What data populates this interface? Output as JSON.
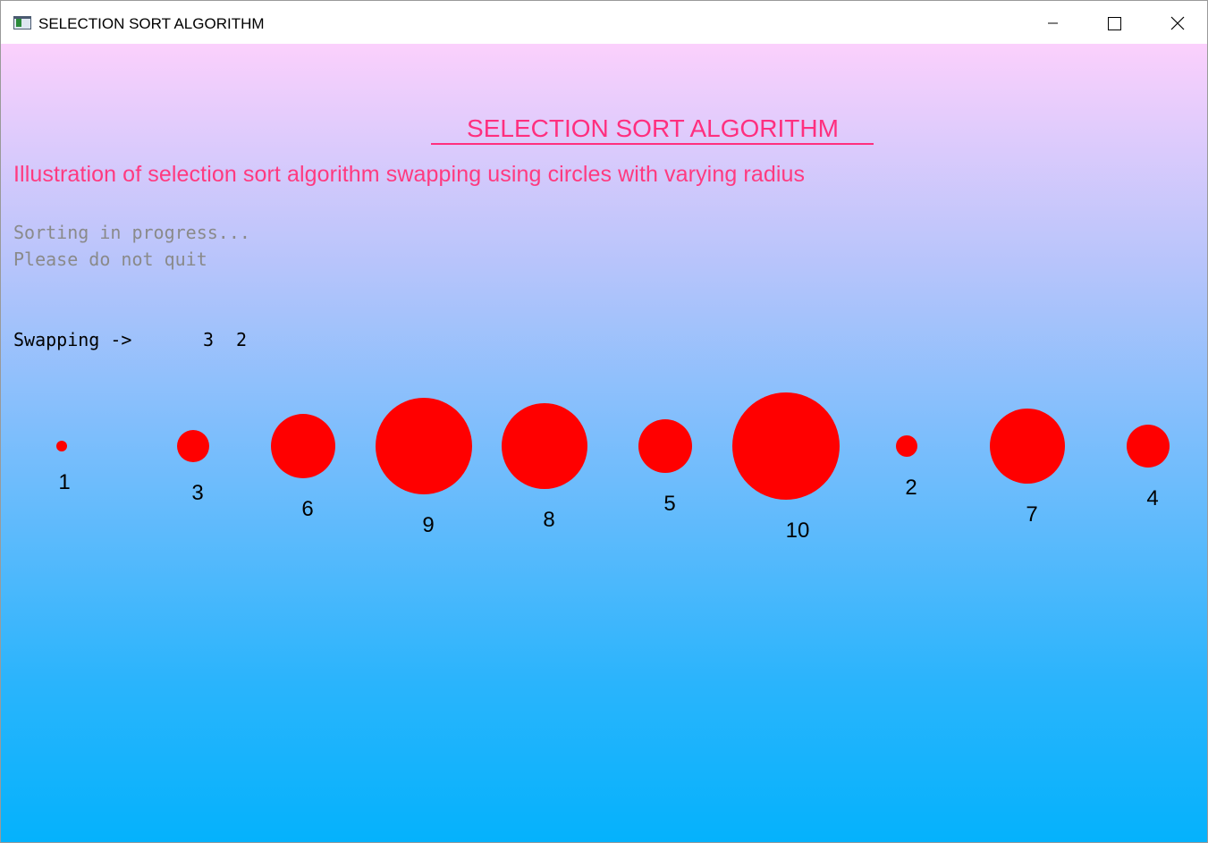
{
  "window": {
    "title": "SELECTION SORT ALGORITHM",
    "controls": {
      "minimize": "minimize-icon",
      "maximize": "maximize-icon",
      "close": "close-icon"
    }
  },
  "canvas": {
    "heading": "SELECTION SORT ALGORITHM",
    "subtitle": "Illustration of selection sort algorithm swapping using circles with varying radius",
    "status_line_1": "Sorting in progress...",
    "status_line_2": "Please do not quit",
    "swap_label": "Swapping ->",
    "swap_values": [
      "3",
      "2"
    ],
    "circles": [
      {
        "label": "1",
        "value": 1
      },
      {
        "label": "3",
        "value": 3
      },
      {
        "label": "6",
        "value": 6
      },
      {
        "label": "9",
        "value": 9
      },
      {
        "label": "8",
        "value": 8
      },
      {
        "label": "5",
        "value": 5
      },
      {
        "label": "10",
        "value": 10
      },
      {
        "label": "2",
        "value": 2
      },
      {
        "label": "7",
        "value": 7
      },
      {
        "label": "4",
        "value": 4
      }
    ]
  },
  "colors": {
    "circle_fill": "#ff0000",
    "heading": "#ff2f7f",
    "status_text": "#8a8a8a",
    "gradient_top": "#fbd0fc",
    "gradient_bottom": "#04b2fc"
  }
}
